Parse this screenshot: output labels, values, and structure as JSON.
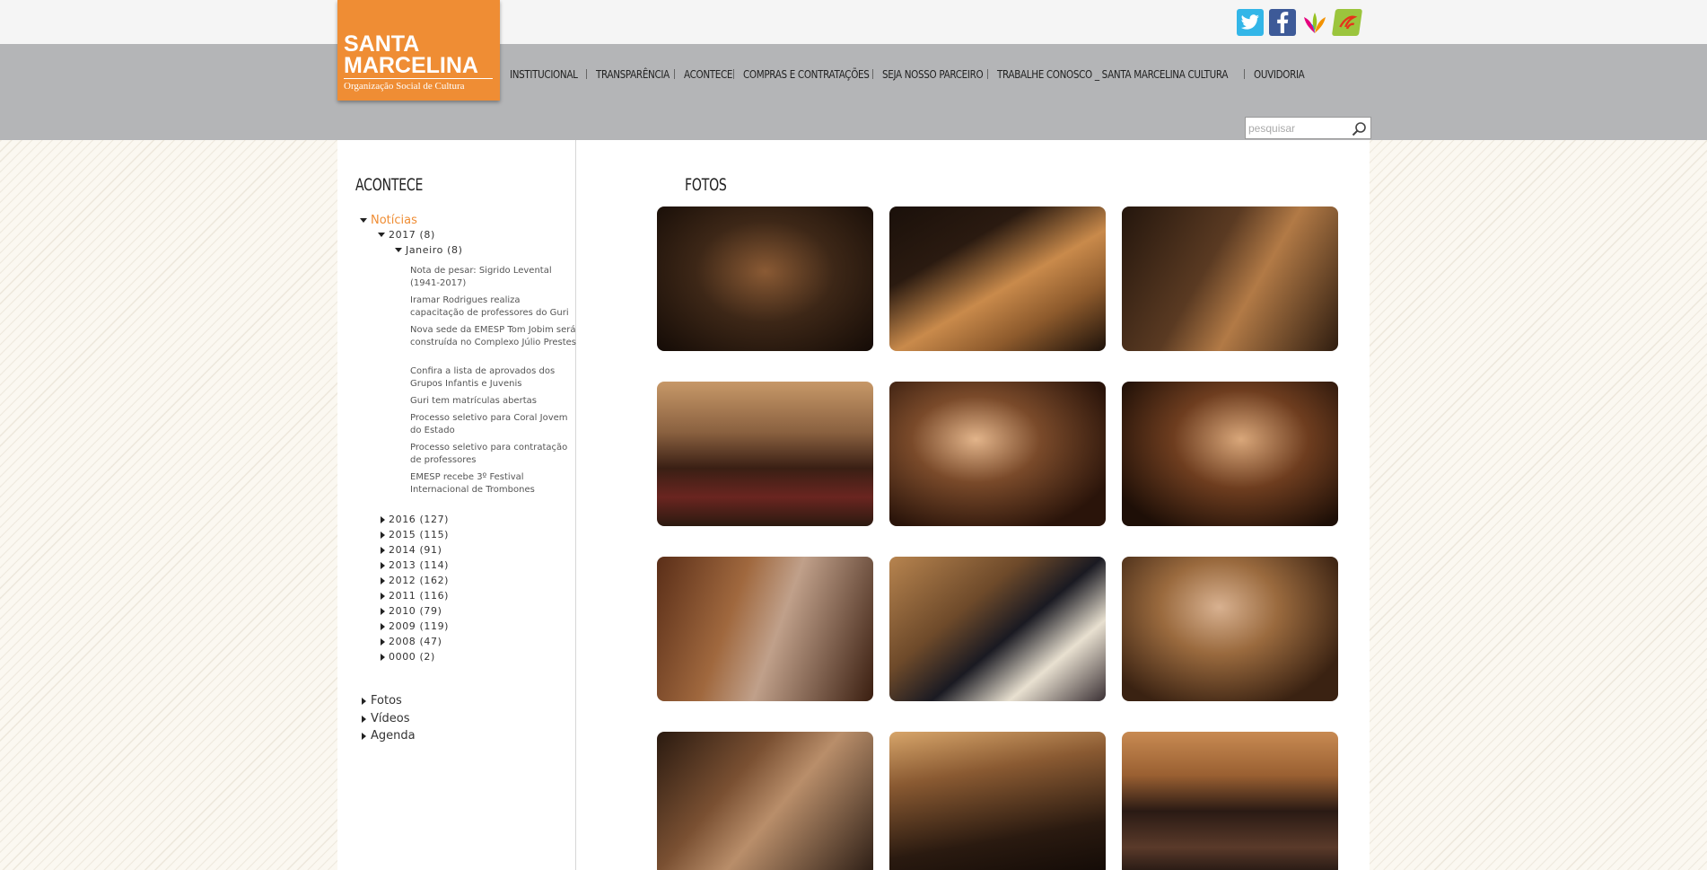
{
  "brand": {
    "line1": "SANTA",
    "line2": "MARCELINA",
    "line3": "Organização Social de Cultura",
    "orange": "#ef8d34"
  },
  "social": [
    "twitter-icon",
    "facebook-icon",
    "flower-icon",
    "leaf-icon"
  ],
  "nav": [
    {
      "label": "INSTITUCIONAL"
    },
    {
      "label": "TRANSPARÊNCIA"
    },
    {
      "label": "ACONTECE"
    },
    {
      "label": "COMPRAS E CONTRATAÇÕES"
    },
    {
      "label": "SEJA NOSSO PARCEIRO"
    },
    {
      "label": "TRABALHE CONOSCO _ SANTA MARCELINA CULTURA"
    },
    {
      "label": "OUVIDORIA"
    }
  ],
  "search": {
    "placeholder": "pesquisar"
  },
  "sidebar": {
    "title": "ACONTECE",
    "noticias": "Notícias",
    "year2017": "2017 (8)",
    "janeiro": "Janeiro (8)",
    "articles": [
      "Nota de pesar: Sigrido Levental (1941-2017)",
      "Iramar Rodrigues realiza capacitação de professores do Guri",
      "Nova sede da EMESP Tom Jobim será construída no Complexo Júlio Prestes",
      "Confira a lista de aprovados dos Grupos Infantis e Juvenis",
      "Guri tem matrículas abertas",
      "Processo seletivo para Coral Jovem do Estado",
      "Processo seletivo para contratação de professores",
      "EMESP recebe 3º Festival Internacional de Trombones"
    ],
    "years": [
      "2016 (127)",
      "2015 (115)",
      "2014 (91)",
      "2013 (114)",
      "2012 (162)",
      "2011 (116)",
      "2010 (79)",
      "2009 (119)",
      "2008 (47)",
      "0000 (2)"
    ],
    "sections": [
      "Fotos",
      "Vídeos",
      "Agenda"
    ]
  },
  "main": {
    "title": "FOTOS"
  }
}
